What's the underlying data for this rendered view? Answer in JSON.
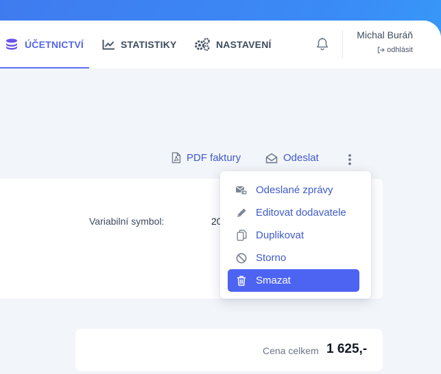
{
  "nav": {
    "items": [
      {
        "label": "ÚČETNICTVÍ",
        "icon": "coins-icon",
        "active": true
      },
      {
        "label": "STATISTIKY",
        "icon": "chart-line-icon",
        "active": false
      },
      {
        "label": "NASTAVENÍ",
        "icon": "gears-icon",
        "active": false
      }
    ]
  },
  "user": {
    "name": "Michal Buráň",
    "logout_label": "odhlásit"
  },
  "actions": {
    "pdf_label": "PDF faktury",
    "send_label": "Odeslat"
  },
  "invoice": {
    "variable_symbol_label": "Variabilní symbol:",
    "variable_symbol_value": "20",
    "total_label": "Cena celkem",
    "total_value": "1 625,-"
  },
  "menu": {
    "items": [
      {
        "label": "Odeslané zprávy",
        "icon": "sent-mail-icon"
      },
      {
        "label": "Editovat dodavatele",
        "icon": "pencil-icon"
      },
      {
        "label": "Duplikovat",
        "icon": "copy-icon"
      },
      {
        "label": "Storno",
        "icon": "ban-icon"
      },
      {
        "label": "Smazat",
        "icon": "trash-icon",
        "highlighted": true
      }
    ]
  },
  "colors": {
    "accent": "#4d63f2",
    "link": "#3e5ac8",
    "background_gradient_start": "#3f7bf0",
    "background_gradient_end": "#2fb0fb"
  }
}
